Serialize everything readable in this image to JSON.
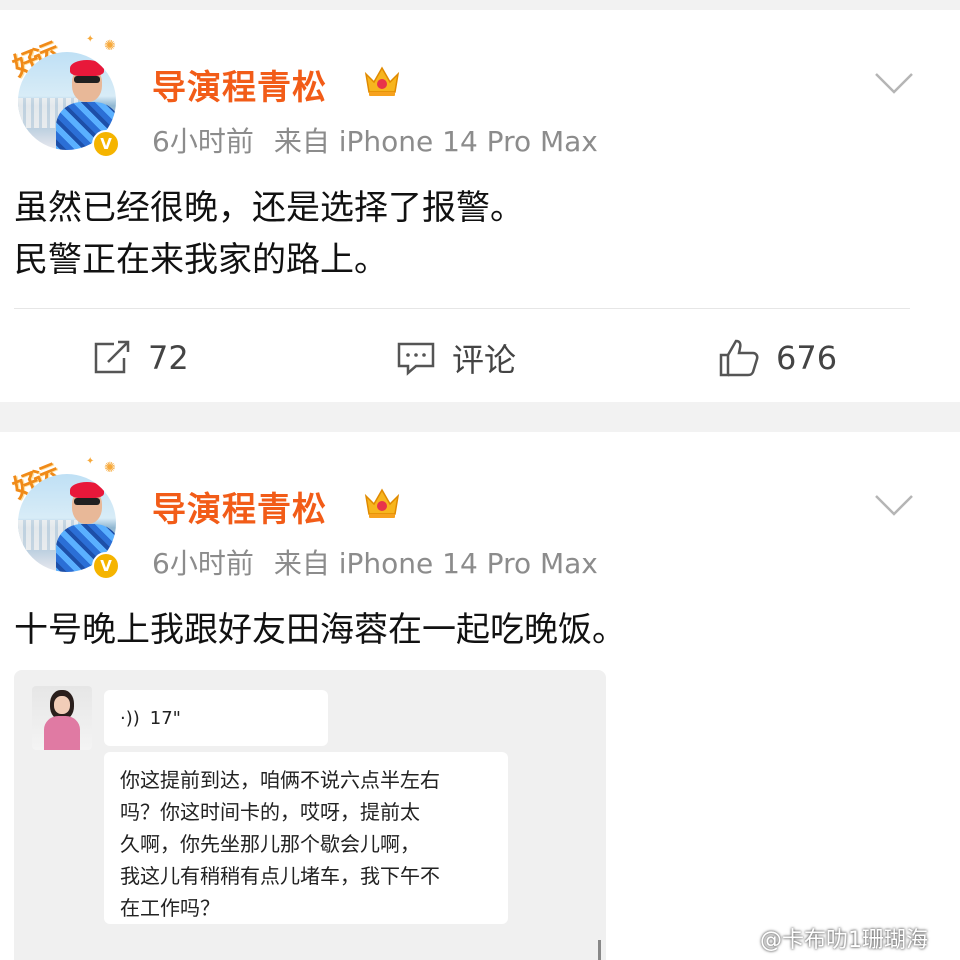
{
  "posts": [
    {
      "username": "导演程青松",
      "time": "6小时前",
      "source": "来自 iPhone 14 Pro Max",
      "lines": [
        "虽然已经很晚，还是选择了报警。",
        "民警正在来我家的路上。"
      ],
      "repost_count": "72",
      "comment_label": "评论",
      "like_count": "676",
      "avatar_tag": "好运"
    },
    {
      "username": "导演程青松",
      "time": "6小时前",
      "source": "来自 iPhone 14 Pro Max",
      "lines": [
        "十号晚上我跟好友田海蓉在一起吃晚饭。"
      ],
      "avatar_tag": "好运"
    }
  ],
  "chat": {
    "voice_duration": "17\"",
    "message_lines": [
      "你这提前到达，咱俩不说六点半左右",
      "吗？你这时间卡的，哎呀，提前太",
      "久啊，你先坐那儿那个歇会儿啊，",
      "我这儿有稍稍有点儿堵车，我下午不",
      "在工作吗？"
    ]
  },
  "watermark": "@卡布叻1珊瑚海",
  "colors": {
    "username": "#f25c18",
    "meta": "#8c8c8c",
    "badge": "#f5b400"
  },
  "icons": [
    "crown-icon",
    "chevron-down-icon",
    "repost-icon",
    "comment-icon",
    "like-icon",
    "verified-icon",
    "weibo-logo-icon"
  ]
}
